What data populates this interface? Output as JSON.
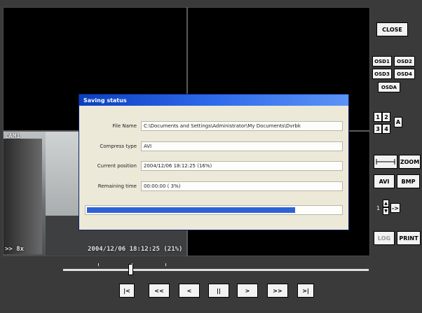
{
  "sidebar": {
    "close": "CLOSE",
    "osd": [
      "OSD1",
      "OSD2",
      "OSD3",
      "OSD4",
      "OSDA"
    ],
    "split": {
      "1": "1",
      "2": "2",
      "3": "3",
      "4": "4",
      "all": "A"
    },
    "zoom": "ZOOM",
    "avi": "AVI",
    "bmp": "BMP",
    "stepper": {
      "value": "1",
      "arrow": "->"
    },
    "log": "LOG",
    "print": "PRINT"
  },
  "camera": {
    "label": "CAM1",
    "speed": ">> 8x",
    "timestamp": "2004/12/06 18:12:25 (21%)"
  },
  "dialog": {
    "title": "Saving status",
    "rows": [
      {
        "label": "File Name",
        "value": "C:\\Documents and Settings\\Administrator\\My Documents\\Dvrbk"
      },
      {
        "label": "Compress type",
        "value": "AVI"
      },
      {
        "label": "Current position",
        "value": "2004/12/06 18:12:25 (16%)"
      },
      {
        "label": "Remaining time",
        "value": "00:00:00 ( 3%)"
      }
    ],
    "progress": 0.82
  },
  "playback": {
    "position": 0.22,
    "controls": [
      "|<",
      "<<",
      "<",
      "||",
      ">",
      ">>",
      ">|"
    ]
  }
}
